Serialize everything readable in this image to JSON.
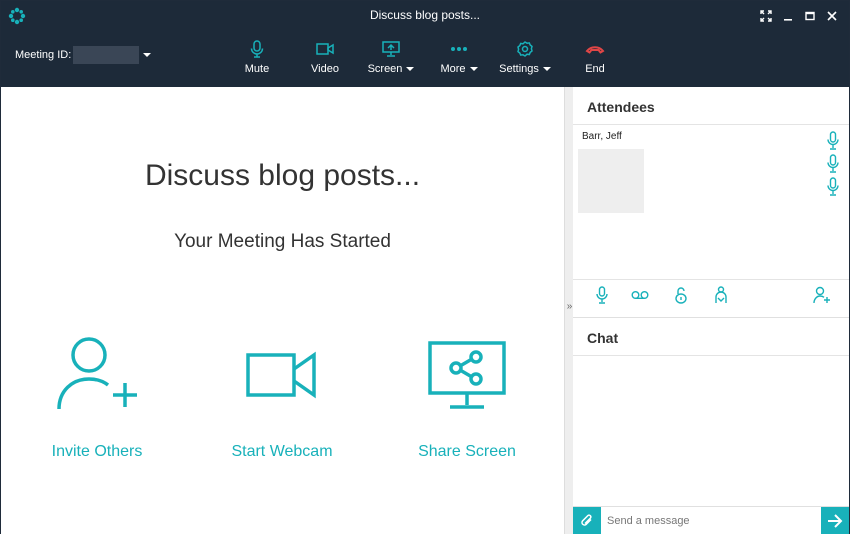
{
  "window": {
    "title": "Discuss blog posts...",
    "accent_color": "#18b1ba",
    "titlebar_color": "#1d2a39"
  },
  "toolbar": {
    "meeting_id_label": "Meeting ID:",
    "items": [
      {
        "label": "Mute",
        "icon": "microphone-icon",
        "dropdown": false
      },
      {
        "label": "Video",
        "icon": "video-camera-icon",
        "dropdown": false
      },
      {
        "label": "Screen",
        "icon": "screen-share-icon",
        "dropdown": true
      },
      {
        "label": "More",
        "icon": "more-dots-icon",
        "dropdown": true
      },
      {
        "label": "Settings",
        "icon": "gear-icon",
        "dropdown": true
      },
      {
        "label": "End",
        "icon": "end-call-icon",
        "dropdown": false,
        "color": "#e04646"
      }
    ]
  },
  "main": {
    "title": "Discuss blog posts...",
    "subtitle": "Your Meeting Has Started",
    "actions": [
      {
        "label": "Invite Others",
        "icon": "add-user-icon"
      },
      {
        "label": "Start Webcam",
        "icon": "webcam-icon"
      },
      {
        "label": "Share Screen",
        "icon": "share-screen-icon"
      }
    ]
  },
  "attendees": {
    "header": "Attendees",
    "list": [
      {
        "name": "Barr, Jeff"
      }
    ],
    "action_icons": [
      "microphone-icon",
      "voicemail-icon",
      "lock-icon",
      "presenter-icon",
      "add-user-icon"
    ]
  },
  "chat": {
    "header": "Chat",
    "input_placeholder": "Send a message"
  }
}
